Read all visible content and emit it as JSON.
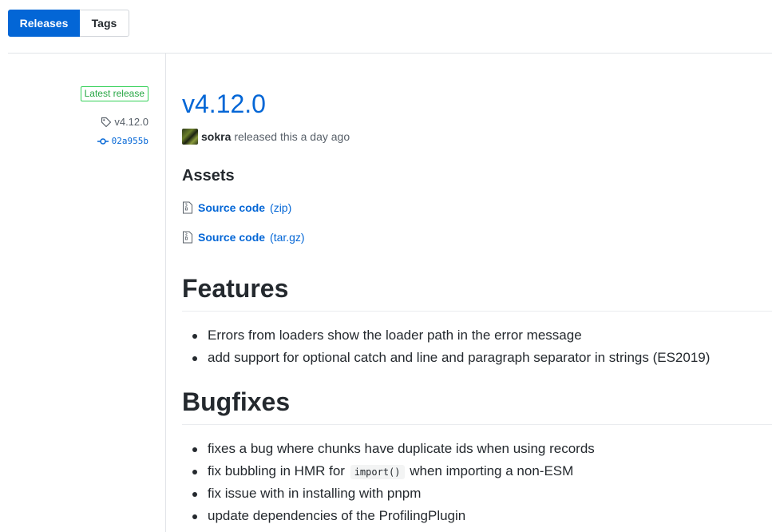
{
  "tabs": [
    {
      "label": "Releases",
      "active": true
    },
    {
      "label": "Tags",
      "active": false
    }
  ],
  "sidebar": {
    "badge": "Latest release",
    "tag": "v4.12.0",
    "commit": "02a955b"
  },
  "release": {
    "title": "v4.12.0",
    "author": "sokra",
    "released_text": "released this a day ago"
  },
  "assets": {
    "title": "Assets",
    "items": [
      {
        "name": "Source code",
        "ext": "(zip)"
      },
      {
        "name": "Source code",
        "ext": "(tar.gz)"
      }
    ]
  },
  "features": {
    "title": "Features",
    "items": [
      "Errors from loaders show the loader path in the error message",
      "add support for optional catch and line and paragraph separator in strings (ES2019)"
    ]
  },
  "bugfixes": {
    "title": "Bugfixes",
    "items": [
      {
        "text": "fixes a bug where chunks have duplicate ids when using records"
      },
      {
        "prefix": "fix bubbling in HMR for",
        "code": "import()",
        "suffix": "when importing a non-ESM"
      },
      {
        "text": "fix issue with in installing with pnpm"
      },
      {
        "text": "update dependencies of the ProfilingPlugin"
      }
    ]
  },
  "colors": {
    "accent": "#0366d6",
    "badge_green": "#28a745",
    "text": "#24292e",
    "muted": "#586069"
  },
  "icons": {
    "tag": "tag-icon",
    "commit": "git-commit-icon",
    "file": "file-zip-icon"
  }
}
